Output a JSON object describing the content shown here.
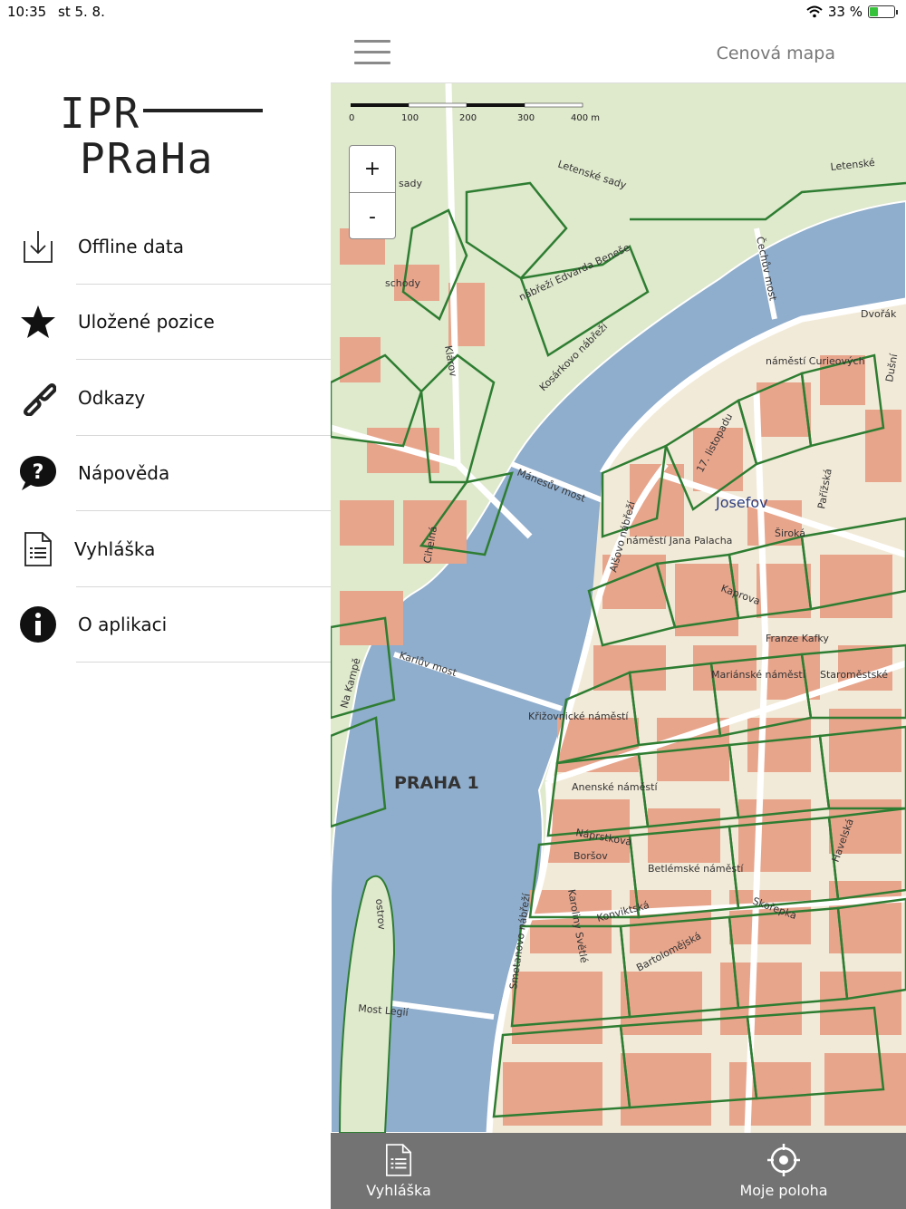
{
  "status": {
    "time": "10:35",
    "date": "st 5. 8.",
    "battery": "33 %",
    "battery_level": 0.33
  },
  "logo": {
    "line1": "IPR",
    "line2": "PRaHa"
  },
  "menu": [
    {
      "label": "Offline data",
      "icon": "download-icon"
    },
    {
      "label": "Uložené pozice",
      "icon": "star-icon"
    },
    {
      "label": "Odkazy",
      "icon": "link-icon"
    },
    {
      "label": "Nápověda",
      "icon": "help-bubble-icon"
    },
    {
      "label": "Vyhláška",
      "icon": "document-icon"
    },
    {
      "label": "O aplikaci",
      "icon": "info-icon"
    }
  ],
  "header": {
    "title": "Cenová mapa"
  },
  "map": {
    "scale": {
      "labels": [
        "0",
        "100",
        "200",
        "300",
        "400 m"
      ]
    },
    "zoom_in": "+",
    "zoom_out": "-",
    "labels": {
      "district": "PRAHA 1",
      "manesuv": "Mánesův most",
      "karluv": "Karlův most",
      "legii": "Most Legií",
      "cechuv": "Čechův most",
      "josefov": "Josefov",
      "letenske": "Letenské sady",
      "letenske2": "Letenské",
      "namesti_jp": "náměstí Jana Palacha",
      "marianske": "Mariánské náměstí",
      "betlemske": "Betlémské náměstí",
      "konviktska": "Konviktská",
      "bartolomejska": "Bartolomějská",
      "naprstkova": "Náprstkova",
      "karoliny": "Karoliny Světlé",
      "smetanovo": "Smetanovo nábřeží",
      "kosarkovo": "Kosárkovo nábřeží",
      "edvarda": "nábřeží Edvarda Beneše",
      "listopadu": "17. listopadu",
      "alsovo": "Alšovo nábřeží",
      "kaprova": "Kaprova",
      "siroka": "Široká",
      "parizska": "Pařížská",
      "curieovych": "náměstí Curieových",
      "dvorak": "Dvořák",
      "skorepka": "Skořepka",
      "havelska": "Havelská",
      "bethlehem_bors": "Boršov",
      "na_kampe": "Na Kampě",
      "cihelna": "Cihelná",
      "klarov": "Klárov",
      "schody": "schody",
      "sady": "sady",
      "dusni": "Dušní",
      "kafky": "Franze Kafky",
      "staromestske": "Staroměstské",
      "krizovnicke": "Křižovnické náměstí",
      "anenske": "Anenské náměstí",
      "ostrov": "ostrov"
    }
  },
  "bottom_bar": {
    "left": {
      "label": "Vyhláška",
      "icon": "document-icon"
    },
    "right": {
      "label": "Moje poloha",
      "icon": "locate-icon"
    }
  },
  "colors": {
    "water": "#8fadcc",
    "park": "#dfe9cc",
    "building": "#e7a58c",
    "boundary": "#2e7d32",
    "road": "#ffffff",
    "bottom_bar": "#737373"
  }
}
